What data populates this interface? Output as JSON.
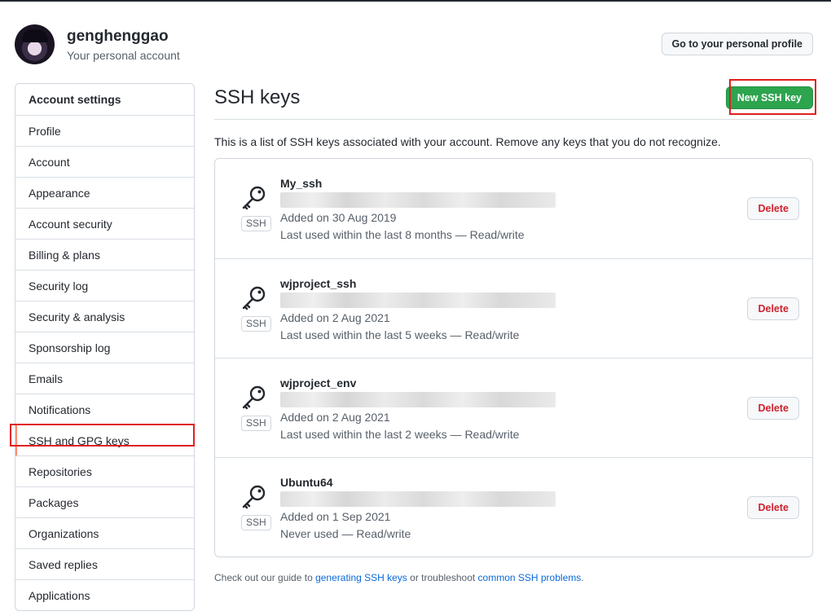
{
  "user": {
    "name": "genghenggao",
    "subtitle": "Your personal account",
    "profile_button": "Go to your personal profile"
  },
  "sidebar": {
    "heading": "Account settings",
    "items": [
      {
        "label": "Profile"
      },
      {
        "label": "Account"
      },
      {
        "label": "Appearance"
      },
      {
        "label": "Account security"
      },
      {
        "label": "Billing & plans"
      },
      {
        "label": "Security log"
      },
      {
        "label": "Security & analysis"
      },
      {
        "label": "Sponsorship log"
      },
      {
        "label": "Emails"
      },
      {
        "label": "Notifications"
      },
      {
        "label": "SSH and GPG keys",
        "selected": true
      },
      {
        "label": "Repositories"
      },
      {
        "label": "Packages"
      },
      {
        "label": "Organizations"
      },
      {
        "label": "Saved replies"
      },
      {
        "label": "Applications"
      }
    ]
  },
  "main": {
    "title": "SSH keys",
    "new_button": "New SSH key",
    "intro": "This is a list of SSH keys associated with your account. Remove any keys that you do not recognize.",
    "badge": "SSH",
    "delete_label": "Delete",
    "keys": [
      {
        "name": "My_ssh",
        "added": "Added on 30 Aug 2019",
        "last_used": "Last used within the last 8 months — Read/write"
      },
      {
        "name": "wjproject_ssh",
        "added": "Added on 2 Aug 2021",
        "last_used": "Last used within the last 5 weeks — Read/write"
      },
      {
        "name": "wjproject_env",
        "added": "Added on 2 Aug 2021",
        "last_used": "Last used within the last 2 weeks — Read/write"
      },
      {
        "name": "Ubuntu64",
        "added": "Added on 1 Sep 2021",
        "last_used": "Never used — Read/write"
      }
    ],
    "footer": {
      "prefix": "Check out our guide to ",
      "link1": "generating SSH keys",
      "middle": " or troubleshoot ",
      "link2": "common SSH problems",
      "suffix": "."
    }
  },
  "colors": {
    "primary_button": "#2da44e",
    "danger_text": "#cf222e",
    "link": "#0969da",
    "annotation_box": "#e0201f"
  }
}
